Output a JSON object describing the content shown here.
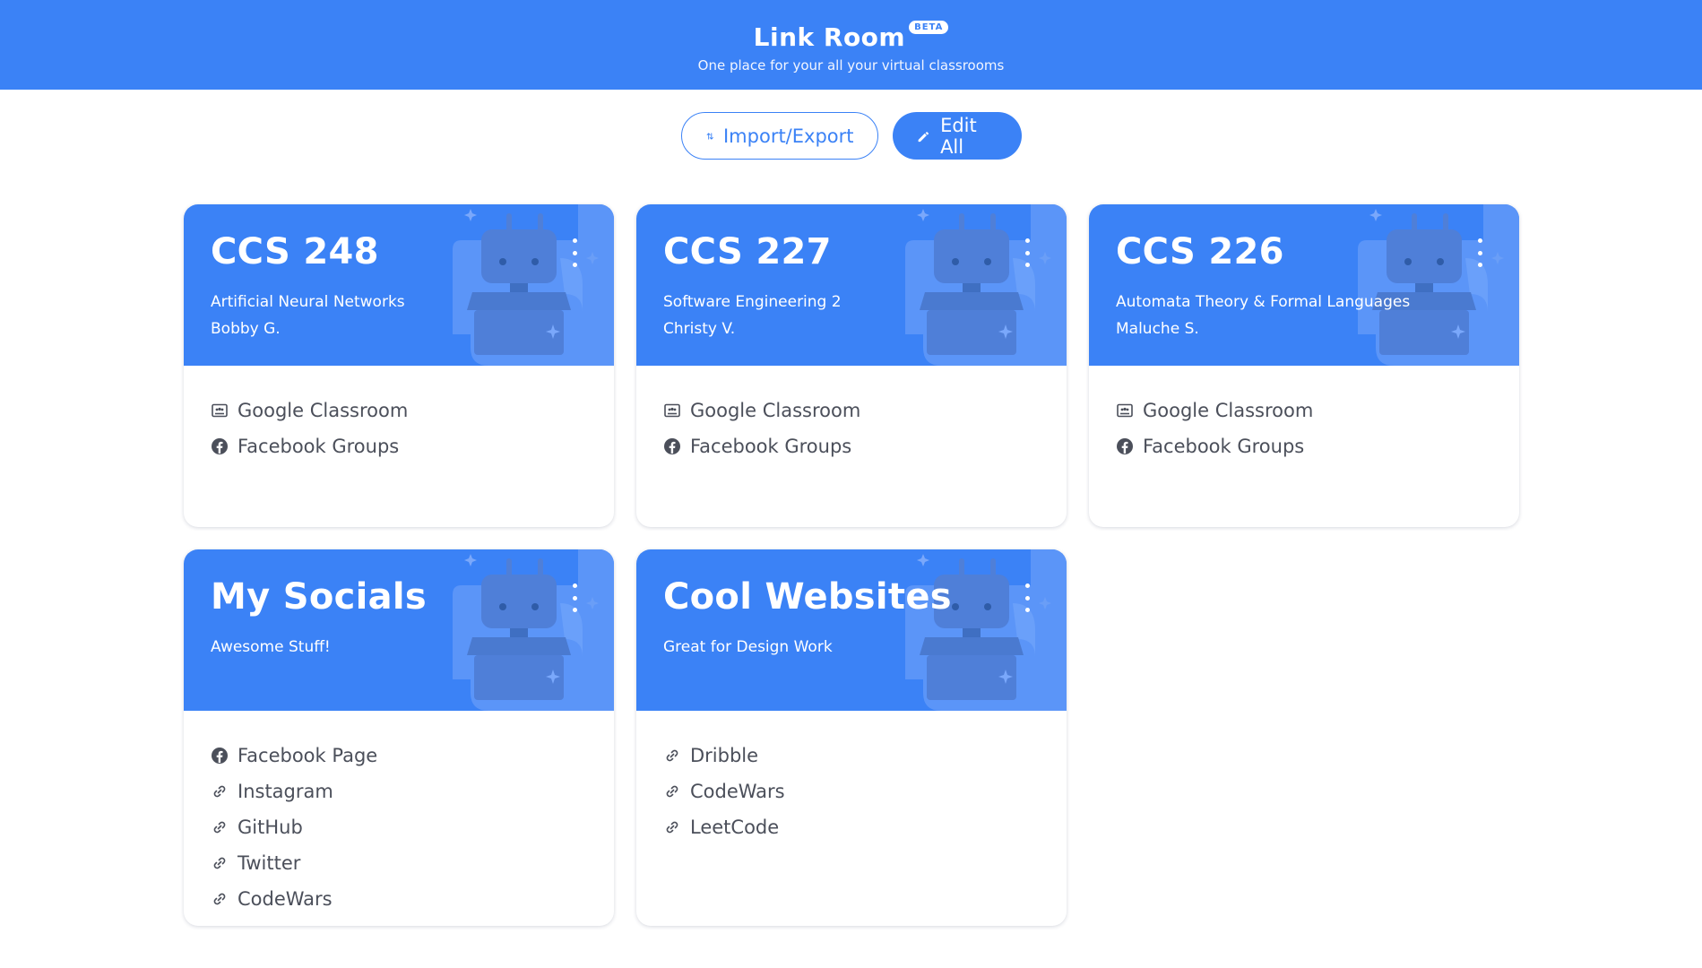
{
  "header": {
    "title": "Link Room",
    "badge": "BETA",
    "tagline": "One place for your all your virtual classrooms",
    "color": "#3b82f6"
  },
  "actions": {
    "import_export_label": "Import/Export",
    "edit_all_label": "Edit All"
  },
  "cards": [
    {
      "title": "CCS 248",
      "subtitle_lines": [
        "Artificial Neural Networks",
        "Bobby G."
      ],
      "links": [
        {
          "label": "Google Classroom",
          "icon": "classroom-icon"
        },
        {
          "label": "Facebook Groups",
          "icon": "facebook-icon"
        }
      ]
    },
    {
      "title": "CCS 227",
      "subtitle_lines": [
        "Software Engineering 2",
        "Christy V."
      ],
      "links": [
        {
          "label": "Google Classroom",
          "icon": "classroom-icon"
        },
        {
          "label": "Facebook Groups",
          "icon": "facebook-icon"
        }
      ]
    },
    {
      "title": "CCS 226",
      "subtitle_lines": [
        "Automata Theory & Formal Languages",
        "Maluche S."
      ],
      "links": [
        {
          "label": "Google Classroom",
          "icon": "classroom-icon"
        },
        {
          "label": "Facebook Groups",
          "icon": "facebook-icon"
        }
      ]
    },
    {
      "title": "My Socials",
      "subtitle_lines": [
        "Awesome Stuff!"
      ],
      "links": [
        {
          "label": "Facebook Page",
          "icon": "facebook-icon"
        },
        {
          "label": "Instagram",
          "icon": "link-icon"
        },
        {
          "label": "GitHub",
          "icon": "link-icon"
        },
        {
          "label": "Twitter",
          "icon": "link-icon"
        },
        {
          "label": "CodeWars",
          "icon": "link-icon"
        }
      ]
    },
    {
      "title": "Cool Websites",
      "subtitle_lines": [
        "Great for Design Work"
      ],
      "links": [
        {
          "label": "Dribble",
          "icon": "link-icon"
        },
        {
          "label": "CodeWars",
          "icon": "link-icon"
        },
        {
          "label": "LeetCode",
          "icon": "link-icon"
        }
      ]
    }
  ]
}
